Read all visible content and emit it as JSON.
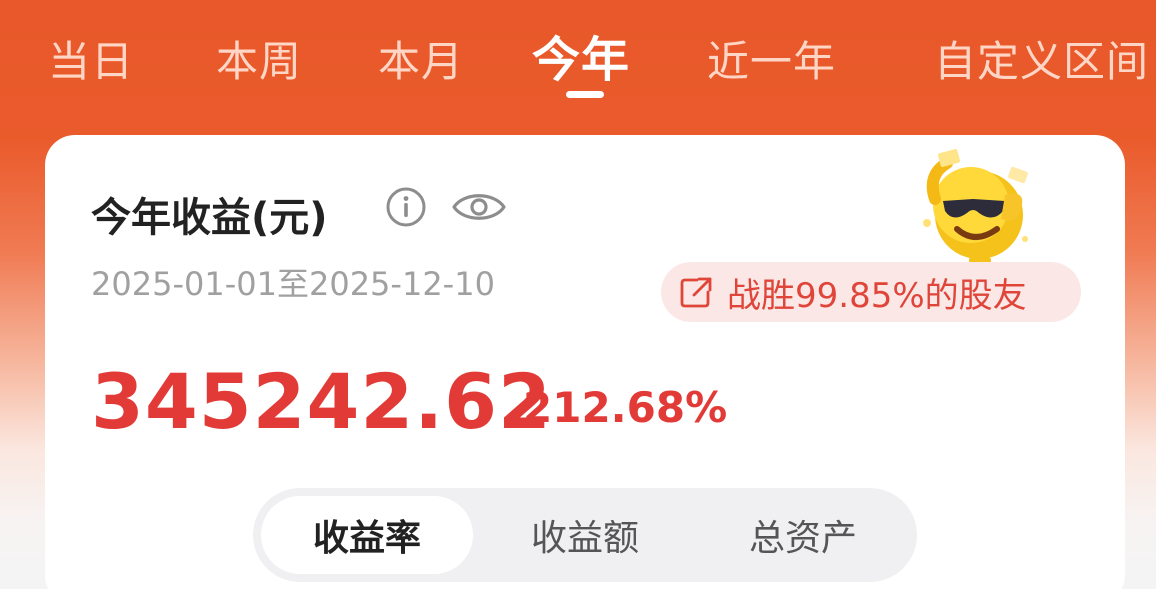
{
  "tabs": [
    {
      "label": "当日",
      "active": false
    },
    {
      "label": "本周",
      "active": false
    },
    {
      "label": "本月",
      "active": false
    },
    {
      "label": "今年",
      "active": true
    },
    {
      "label": "近一年",
      "active": false
    },
    {
      "label": "自定义区间",
      "active": false
    }
  ],
  "card": {
    "title": "今年收益(元)",
    "date_range": "2025-01-01至2025-12-10",
    "badge_text": "战胜99.85%的股友",
    "amount": "345242.62",
    "percent": "212.68%"
  },
  "segments": [
    {
      "label": "收益率",
      "active": true
    },
    {
      "label": "收益额",
      "active": false
    },
    {
      "label": "总资产",
      "active": false
    }
  ],
  "colors": {
    "header": "#e8582a",
    "gain_red": "#e23b37",
    "badge_bg": "#fbe8e6"
  },
  "icons": [
    "info-icon",
    "eye-icon",
    "share-icon",
    "mascot-emoji-icon"
  ]
}
